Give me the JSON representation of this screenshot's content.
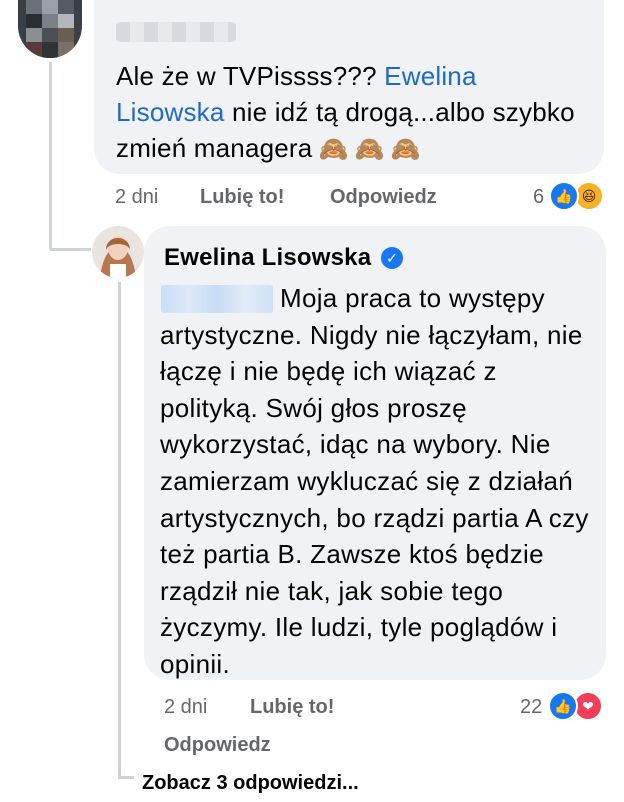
{
  "comment1": {
    "text_part1": "Ale że w TVPissss??? ",
    "mention": "Ewelina Lisowska",
    "text_part2": "  nie idź tą drogą...albo szybko zmień managera",
    "emojis": [
      "🙈",
      "🙈",
      "🙈"
    ],
    "time": "2 dni",
    "like_label": "Lubię to!",
    "reply_label": "Odpowiedz",
    "reaction_count": "6",
    "reactions": [
      "like-icon",
      "haha-icon"
    ]
  },
  "reply": {
    "author": "Ewelina Lisowska",
    "verified_icon": "verified-badge-icon",
    "text": "Moja praca to występy artystyczne. Nigdy nie łączyłam, nie łączę i nie będę ich wiązać z polityką. Swój głos proszę wykorzystać, idąc na wybory. Nie zamierzam wykluczać się z działań artystycznych, bo rządzi partia A czy też partia B. Zawsze ktoś będzie rządził nie tak, jak sobie tego życzymy. Ile ludzi, tyle poglądów i opinii.",
    "time": "2 dni",
    "like_label": "Lubię to!",
    "reply_label": "Odpowiedz",
    "reaction_count": "22",
    "reactions": [
      "like-icon",
      "love-icon"
    ]
  },
  "view_more": "Zobacz 3 odpowiedzi...",
  "colors": {
    "bubble": "#f0f2f5",
    "mention": "#1b6ac9",
    "meta": "#65676b",
    "like": "#1877f2",
    "love": "#f33e58"
  }
}
